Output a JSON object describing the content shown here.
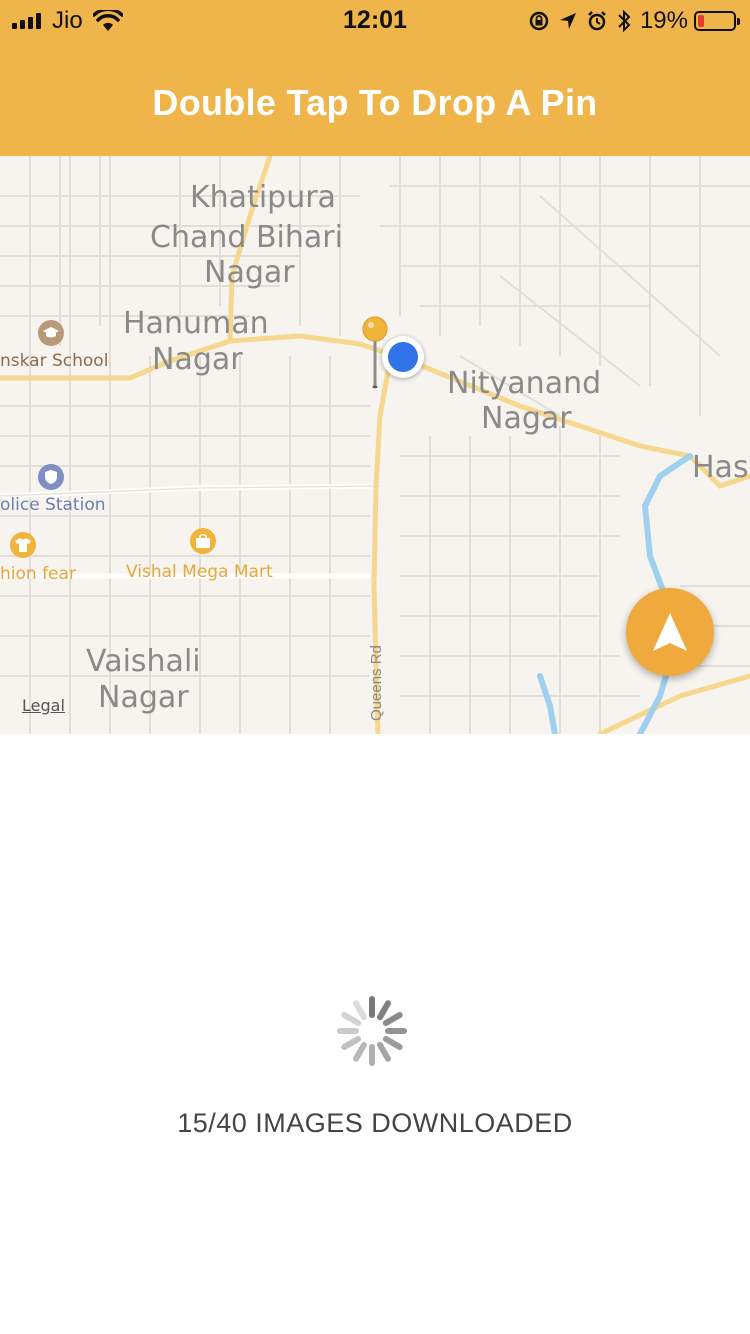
{
  "status_bar": {
    "carrier": "Jio",
    "time": "12:01",
    "battery_percent": "19%",
    "battery_level": 0.19,
    "icons": [
      "signal-icon",
      "wifi-icon",
      "rotation-lock-icon",
      "location-arrow-icon",
      "alarm-icon",
      "bluetooth-icon",
      "battery-icon"
    ]
  },
  "header": {
    "title": "Double Tap To Drop A Pin"
  },
  "map": {
    "labels": {
      "khatipura": "Khatipura",
      "chand_bihari_1": "Chand Bihari",
      "chand_bihari_2": "Nagar",
      "hanuman_1": "Hanuman",
      "hanuman_2": "Nagar",
      "nityanand_1": "Nityanand",
      "nityanand_2": "Nagar",
      "vaishali_1": "Vaishali",
      "vaishali_2": "Nagar",
      "has": "Has",
      "queens_rd": "Queens Rd"
    },
    "pois": {
      "school": "nskar School",
      "police": "olice Station",
      "fashion": "hion fear",
      "mart": "Vishal Mega Mart"
    },
    "legal": "Legal",
    "colors": {
      "road_major": "#f5d78e",
      "road_minor": "#e2ddd5",
      "water": "#9fd0ef",
      "background": "#f7f4ef",
      "user_location": "#2f73e6",
      "pin_head": "#f0b43c"
    }
  },
  "loading": {
    "text": "15/40 IMAGES DOWNLOADED",
    "downloaded": 15,
    "total": 40
  },
  "theme": {
    "accent": "#efb54a",
    "nav_button": "#efa93c"
  }
}
